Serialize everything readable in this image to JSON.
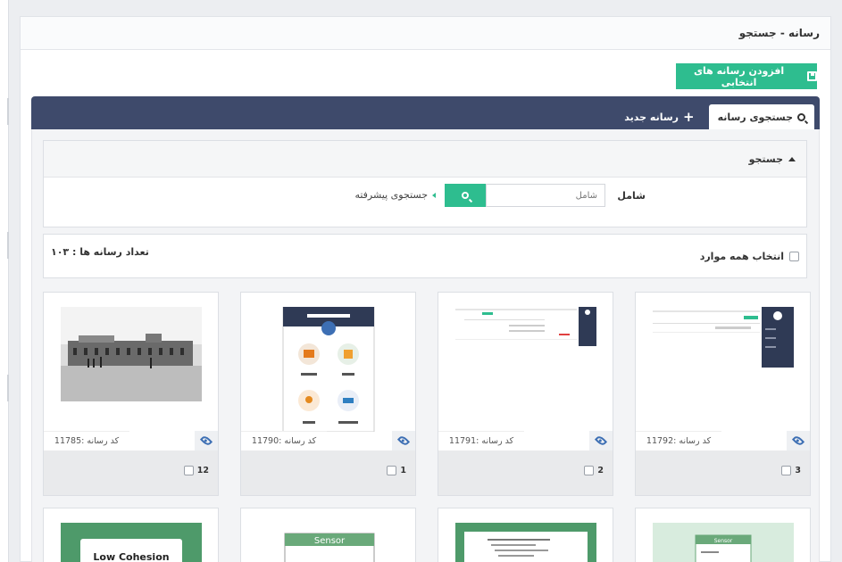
{
  "page": {
    "title": "رسانه - جستجو"
  },
  "toolbar": {
    "add_selected_label": "افزودن رسانه های انتخابی"
  },
  "tabs": [
    {
      "label": "جستجوی رسانه",
      "active": true
    },
    {
      "label": "رسانه جدید",
      "active": false
    }
  ],
  "search": {
    "section_title": "جستجو",
    "contains_label": "شامل",
    "input_placeholder": "شامل",
    "input_value": "",
    "advanced_label": "جستجوی پیشرفته"
  },
  "bulk": {
    "select_all_label": "انتخاب همه موارد",
    "count_text": "تعداد رسانه ها : ۱۰۳"
  },
  "colors": {
    "accent": "#2ebd8f",
    "tabbar": "#3e4a6b",
    "eye": "#3d6fb4"
  },
  "cards": [
    {
      "code": "کد رسانه :11785",
      "number": "12",
      "thumb": "historic-photo"
    },
    {
      "code": "کد رسانه :11790",
      "number": "1",
      "thumb": "mobile-app-screenshot"
    },
    {
      "code": "کد رسانه :11791",
      "number": "2",
      "thumb": "admin-form-screenshot"
    },
    {
      "code": "کد رسانه :11792",
      "number": "3",
      "thumb": "admin-panel-screenshot"
    }
  ],
  "cards_row2": [
    {
      "thumb_text": "Low Cohesion"
    },
    {
      "thumb_text": "Sensor"
    },
    {
      "thumb_text": ""
    },
    {
      "thumb_text": "Sensor"
    }
  ]
}
